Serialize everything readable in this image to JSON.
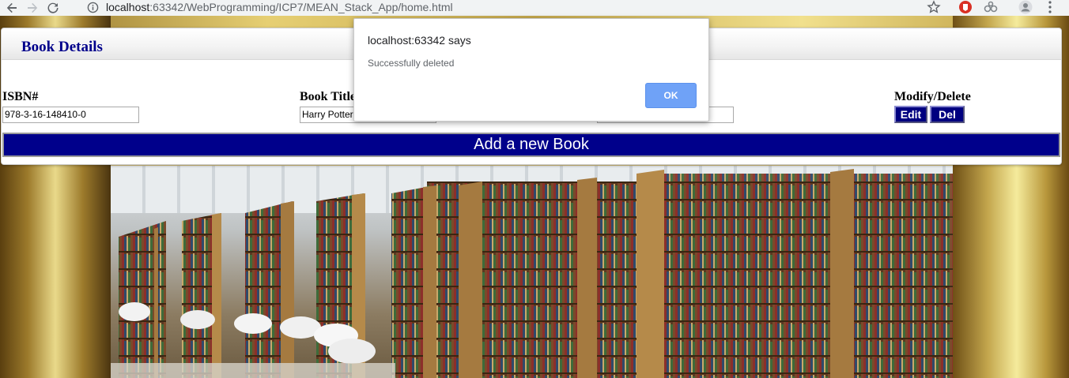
{
  "browser": {
    "url_host": "localhost",
    "url_path": ":63342/WebProgramming/ICP7/MEAN_Stack_App/home.html"
  },
  "panel": {
    "title": "Book Details",
    "columns": {
      "isbn": "ISBN#",
      "book_title": "Book Title",
      "modify_delete": "Modify/Delete"
    },
    "row": {
      "isbn_value": "978-3-16-148410-0",
      "title_value": "Harry Potter",
      "third_value": ""
    },
    "edit_label": "Edit",
    "delete_label": "Del",
    "add_label": "Add a new Book"
  },
  "dialog": {
    "title": "localhost:63342 says",
    "message": "Successfully deleted",
    "ok_label": "OK"
  },
  "colors": {
    "accent_navy": "#00008b",
    "dialog_button": "#6fa2f7"
  }
}
